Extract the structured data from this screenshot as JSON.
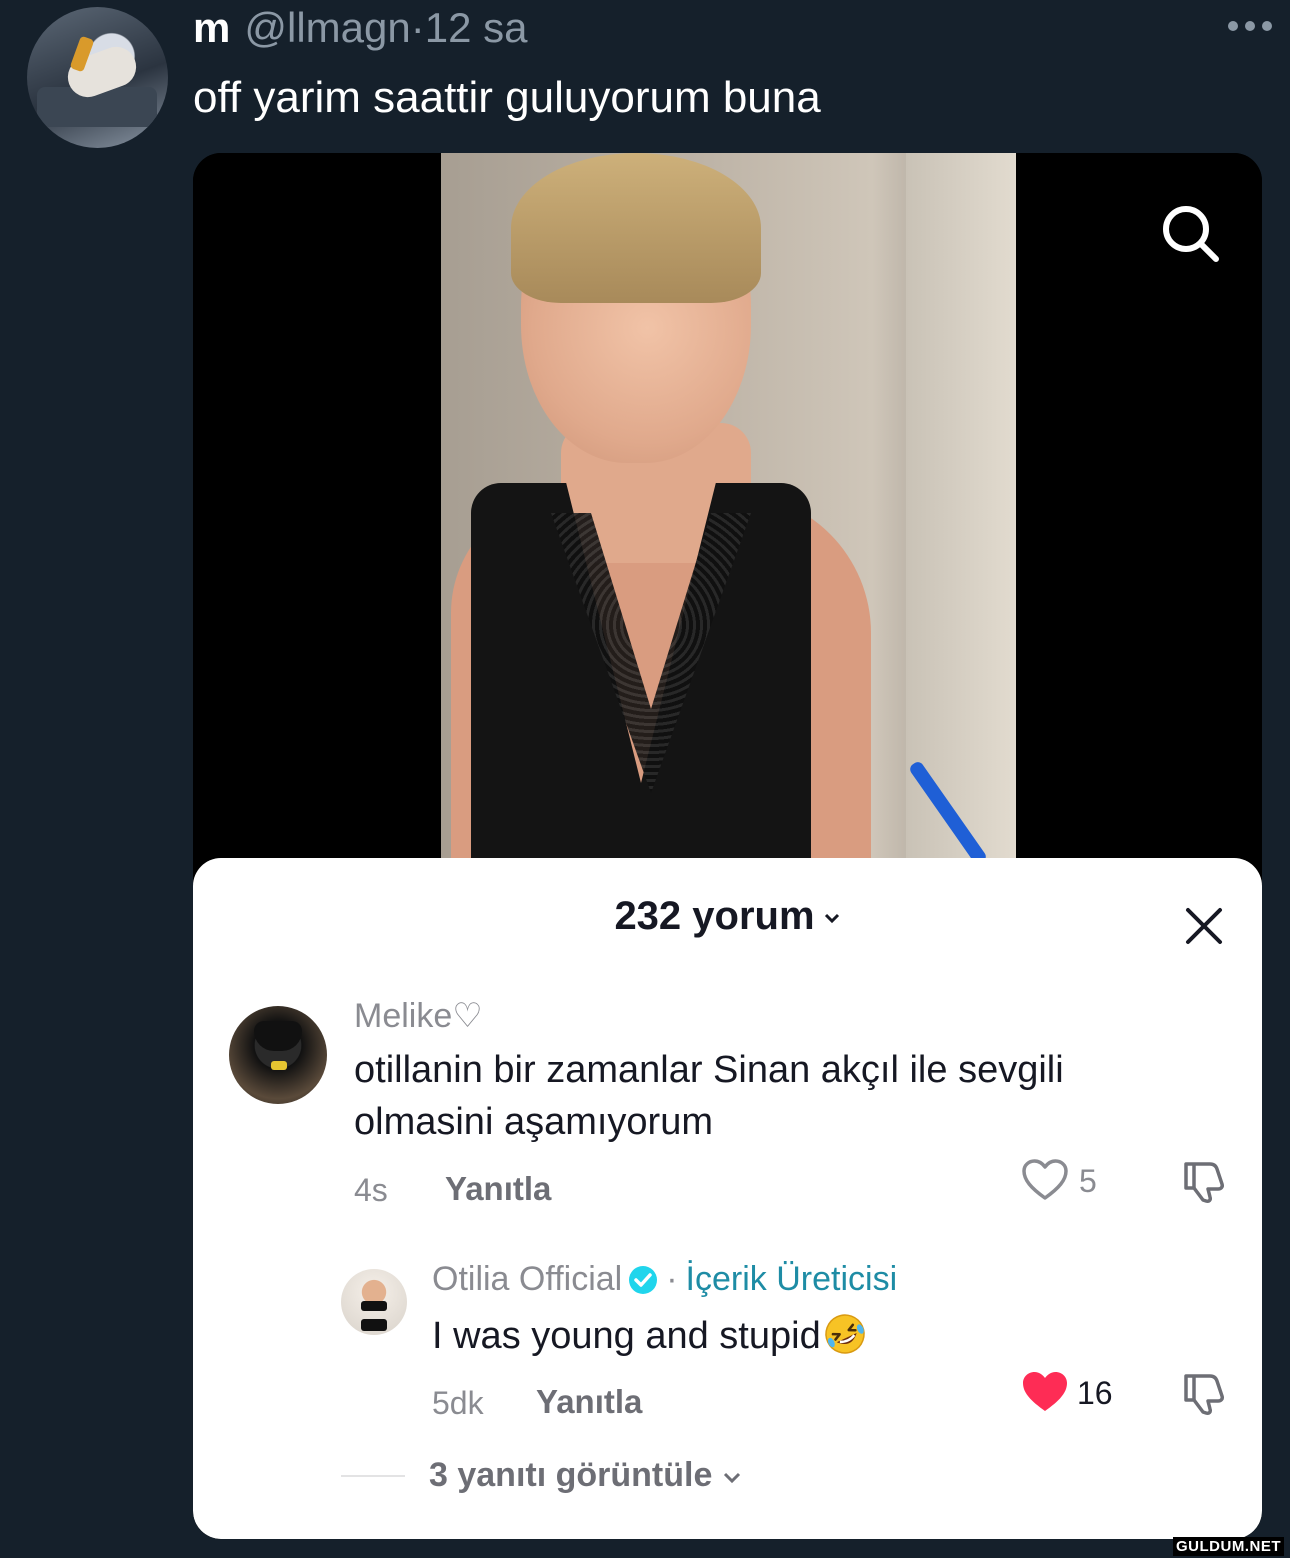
{
  "tweet": {
    "display_name": "m",
    "handle": "@llmagn",
    "separator": "·",
    "time": "12 sa",
    "text": "off yarim saattir guluyorum buna"
  },
  "tiktok_screenshot": {
    "comments_title": "232 yorum",
    "comments": [
      {
        "username": "Melike♡",
        "text": "otillanin bir zamanlar Sinan akçıl ile sevgili olmasini aşamıyorum",
        "time": "4s",
        "reply_label": "Yanıtla",
        "likes": "5",
        "liked": false
      },
      {
        "username": "Otilia Official",
        "verified": true,
        "separator": "·",
        "badge": "İçerik Üreticisi",
        "text": "I was young and stupid",
        "emoji": "rolling-on-floor-laughing",
        "time": "5dk",
        "reply_label": "Yanıtla",
        "likes": "16",
        "liked": true
      }
    ],
    "view_replies": "3 yanıtı görüntüle"
  },
  "watermark": "GULDUM.NET",
  "colors": {
    "background": "#15202b",
    "secondary_text": "#8b98a5",
    "like_red": "#fe2c55",
    "verified_teal": "#20d5ec",
    "creator_text": "#1e8ca5"
  }
}
